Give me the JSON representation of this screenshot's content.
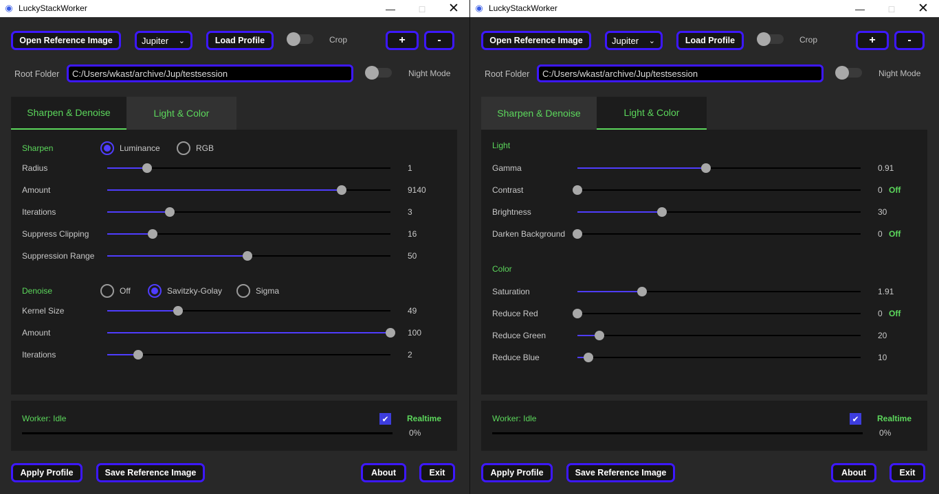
{
  "windows": [
    {
      "title": "LuckyStackWorker",
      "toolbar": {
        "open_ref": "Open Reference Image",
        "profile_select": "Jupiter",
        "load_profile": "Load Profile",
        "crop_label": "Crop",
        "plus": "+",
        "minus": "-"
      },
      "root": {
        "label": "Root Folder",
        "value": "C:/Users/wkast/archive/Jup/testsession",
        "night_mode_label": "Night Mode"
      },
      "tabs": [
        {
          "label": "Sharpen & Denoise",
          "active": true
        },
        {
          "label": "Light & Color",
          "active": false
        }
      ],
      "panel": "sharpen",
      "sharpen": {
        "title": "Sharpen",
        "modes": [
          {
            "label": "Luminance",
            "selected": true
          },
          {
            "label": "RGB",
            "selected": false
          }
        ],
        "sliders": [
          {
            "name": "Radius",
            "value": "1",
            "position": 0.14
          },
          {
            "name": "Amount",
            "value": "9140",
            "position": 0.828
          },
          {
            "name": "Iterations",
            "value": "3",
            "position": 0.222
          },
          {
            "name": "Suppress Clipping",
            "value": "16",
            "position": 0.16
          },
          {
            "name": "Suppression Range",
            "value": "50",
            "position": 0.495
          }
        ]
      },
      "denoise": {
        "title": "Denoise",
        "modes": [
          {
            "label": "Off",
            "selected": false
          },
          {
            "label": "Savitzky-Golay",
            "selected": true
          },
          {
            "label": "Sigma",
            "selected": false
          }
        ],
        "sliders": [
          {
            "name": "Kernel Size",
            "value": "49",
            "position": 0.249
          },
          {
            "name": "Amount",
            "value": "100",
            "position": 1.0
          },
          {
            "name": "Iterations",
            "value": "2",
            "position": 0.11
          }
        ]
      },
      "status": {
        "worker": "Worker: Idle",
        "realtime_label": "Realtime",
        "realtime_checked": true,
        "progress": 0,
        "progress_text": "0%"
      },
      "footer": {
        "apply_profile": "Apply Profile",
        "save_ref": "Save Reference Image",
        "about": "About",
        "exit": "Exit"
      }
    },
    {
      "title": "LuckyStackWorker",
      "toolbar": {
        "open_ref": "Open Reference Image",
        "profile_select": "Jupiter",
        "load_profile": "Load Profile",
        "crop_label": "Crop",
        "plus": "+",
        "minus": "-"
      },
      "root": {
        "label": "Root Folder",
        "value": "C:/Users/wkast/archive/Jup/testsession",
        "night_mode_label": "Night Mode"
      },
      "tabs": [
        {
          "label": "Sharpen & Denoise",
          "active": false
        },
        {
          "label": "Light & Color",
          "active": true
        }
      ],
      "panel": "light",
      "light": {
        "title": "Light",
        "sliders": [
          {
            "name": "Gamma",
            "value": "0.91",
            "position": 0.455
          },
          {
            "name": "Contrast",
            "value": "0",
            "position": 0,
            "off_label": "Off"
          },
          {
            "name": "Brightness",
            "value": "30",
            "position": 0.299
          },
          {
            "name": "Darken Background",
            "value": "0",
            "position": 0,
            "off_label": "Off"
          }
        ]
      },
      "color": {
        "title": "Color",
        "sliders": [
          {
            "name": "Saturation",
            "value": "1.91",
            "position": 0.227
          },
          {
            "name": "Reduce Red",
            "value": "0",
            "position": 0,
            "off_label": "Off"
          },
          {
            "name": "Reduce Green",
            "value": "20",
            "position": 0.078
          },
          {
            "name": "Reduce Blue",
            "value": "10",
            "position": 0.039
          }
        ]
      },
      "status": {
        "worker": "Worker: Idle",
        "realtime_label": "Realtime",
        "realtime_checked": true,
        "progress": 0,
        "progress_text": "0%"
      },
      "footer": {
        "apply_profile": "Apply Profile",
        "save_ref": "Save Reference Image",
        "about": "About",
        "exit": "Exit"
      }
    }
  ],
  "icons": {
    "app": "planet-app-icon",
    "minimize": "minimize-icon",
    "maximize": "maximize-icon",
    "close": "close-icon",
    "dropdown": "chevron-down-icon",
    "check": "checkmark-icon"
  },
  "colors": {
    "accent": "#3d18ff",
    "slider_fill": "#4f3dff",
    "green": "#5cd85c",
    "panel": "#1c1c1c",
    "background": "#282828"
  }
}
